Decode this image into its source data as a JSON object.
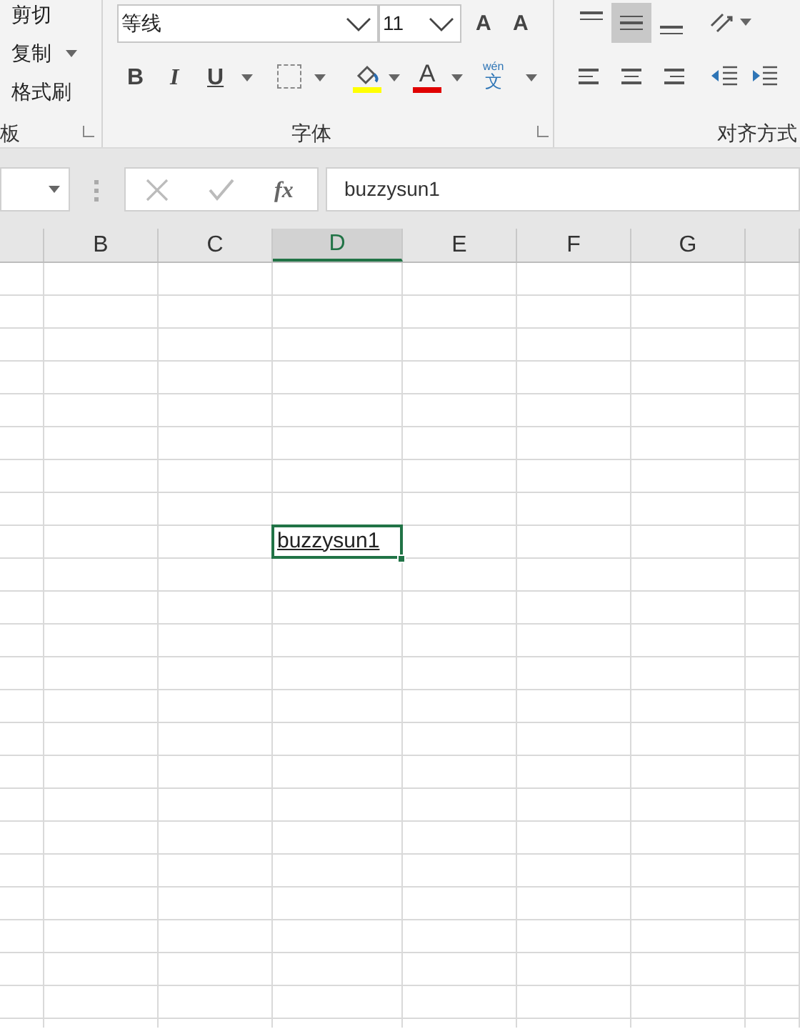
{
  "ribbon": {
    "clipboard": {
      "commands": [
        {
          "label": "剪切",
          "dropdown": false
        },
        {
          "label": "复制",
          "dropdown": true
        },
        {
          "label": "格式刷",
          "dropdown": false
        }
      ],
      "group_label": "板"
    },
    "font": {
      "font_name": "等线",
      "font_size": "11",
      "grow": "A",
      "shrink": "A",
      "bold": "B",
      "italic": "I",
      "underline": "U",
      "font_color": "A",
      "phonetic_top": "wén",
      "phonetic_bottom": "文",
      "group_label": "字体"
    },
    "alignment": {
      "vertical": [
        {
          "selected": false
        },
        {
          "selected": true
        },
        {
          "selected": false
        }
      ],
      "group_label": "对齐方式"
    }
  },
  "formula_bar": {
    "fx": "fx",
    "value": "buzzysun1"
  },
  "sheet": {
    "columns": [
      {
        "selected": false
      },
      {
        "label": "B",
        "selected": false
      },
      {
        "label": "C",
        "selected": false
      },
      {
        "label": "D",
        "selected": true
      },
      {
        "label": "E",
        "selected": false
      },
      {
        "label": "F",
        "selected": false
      },
      {
        "label": "G",
        "selected": false
      },
      {
        "selected": false
      }
    ],
    "active_cell": {
      "text": "buzzysun1"
    }
  }
}
